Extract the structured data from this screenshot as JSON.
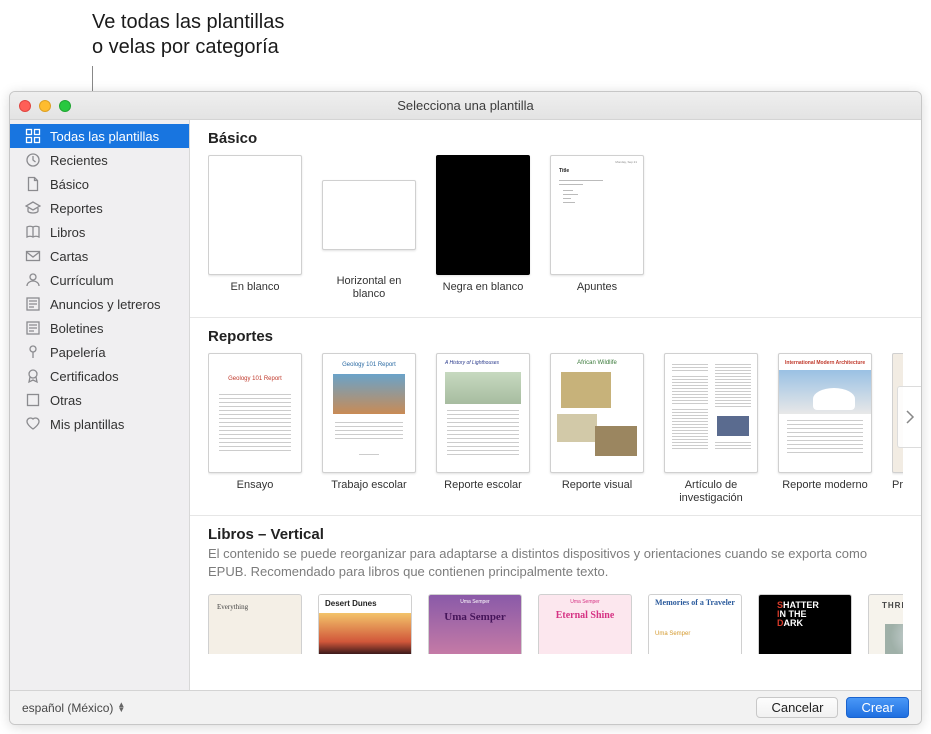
{
  "annotation": "Ve todas las plantillas\no velas por categoría",
  "window_title": "Selecciona una plantilla",
  "sidebar": {
    "items": [
      {
        "label": "Todas las plantillas",
        "icon": "grid",
        "selected": true
      },
      {
        "label": "Recientes",
        "icon": "clock",
        "selected": false
      },
      {
        "label": "Básico",
        "icon": "doc",
        "selected": false
      },
      {
        "label": "Reportes",
        "icon": "gradcap",
        "selected": false
      },
      {
        "label": "Libros",
        "icon": "book",
        "selected": false
      },
      {
        "label": "Cartas",
        "icon": "envelope",
        "selected": false
      },
      {
        "label": "Currículum",
        "icon": "person",
        "selected": false
      },
      {
        "label": "Anuncios y letreros",
        "icon": "lines",
        "selected": false
      },
      {
        "label": "Boletines",
        "icon": "lines",
        "selected": false
      },
      {
        "label": "Papelería",
        "icon": "pin",
        "selected": false
      },
      {
        "label": "Certificados",
        "icon": "ribbon",
        "selected": false
      },
      {
        "label": "Otras",
        "icon": "box",
        "selected": false
      },
      {
        "label": "Mis plantillas",
        "icon": "heart",
        "selected": false
      }
    ]
  },
  "sections": {
    "basico": {
      "title": "Básico",
      "cards": [
        {
          "label": "En blanco"
        },
        {
          "label": "Horizontal en blanco"
        },
        {
          "label": "Negra en blanco"
        },
        {
          "label": "Apuntes"
        }
      ]
    },
    "reportes": {
      "title": "Reportes",
      "cards": [
        {
          "label": "Ensayo",
          "thumb_title": "Geology 101 Report"
        },
        {
          "label": "Trabajo escolar",
          "thumb_title": "Geology 101 Report"
        },
        {
          "label": "Reporte escolar",
          "thumb_title": "A History of Lighthouses"
        },
        {
          "label": "Reporte visual",
          "thumb_title": "African Wildlife"
        },
        {
          "label": "Artículo de investigación"
        },
        {
          "label": "Reporte moderno",
          "thumb_title": "International Modern Architecture"
        },
        {
          "label": "Propuesta de proyecto"
        }
      ]
    },
    "libros": {
      "title": "Libros – Vertical",
      "desc": "El contenido se puede reorganizar para adaptarse a distintos dispositivos y orientaciones cuando se exporta como EPUB. Recomendado para libros que contienen principalmente texto.",
      "books": [
        {
          "cover_title": "Everything"
        },
        {
          "cover_title": "Desert Dunes"
        },
        {
          "cover_author": "Uma Semper",
          "cover_title": "Uma Semper"
        },
        {
          "cover_author": "Uma Semper",
          "cover_title": "Eternal Shine"
        },
        {
          "cover_title": "Memories of a Traveler",
          "cover_author": "Uma Semper"
        },
        {
          "cover_title": "SHATTER IN THE DARK"
        },
        {
          "cover_title": "THREE TALES"
        }
      ]
    }
  },
  "footer": {
    "language": "español (México)",
    "cancel": "Cancelar",
    "create": "Crear"
  }
}
